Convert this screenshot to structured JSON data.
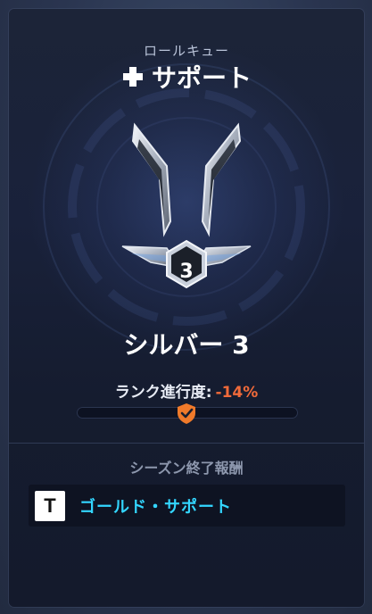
{
  "role": {
    "queue_label": "ロールキュー",
    "name": "サポート",
    "icon": "plus-icon"
  },
  "rank": {
    "emblem": "silver-rank-emblem",
    "tier_number": "3",
    "name": "シルバー 3"
  },
  "progress": {
    "label": "ランク進行度:",
    "value": "-14%",
    "fill_fraction": 0.5,
    "marker_icon": "shield-check-icon"
  },
  "season": {
    "title": "シーズン終了報酬",
    "reward": {
      "icon": "t-reward-icon",
      "icon_letter": "T",
      "label": "ゴールド・サポート"
    }
  },
  "colors": {
    "accent_orange": "#f06a3a",
    "reward_cyan": "#33d6ff"
  }
}
